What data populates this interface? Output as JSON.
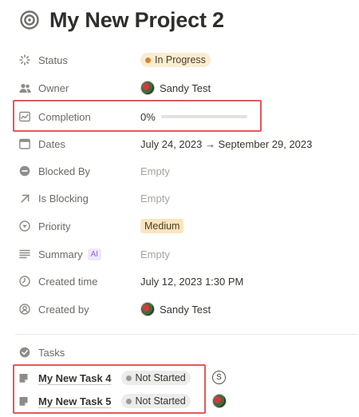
{
  "page": {
    "title": "My New Project 2",
    "icon": "target-icon"
  },
  "properties": [
    {
      "key": "status",
      "label": "Status",
      "icon": "status-spinner-icon",
      "value": "In Progress",
      "value_type": "status-pill",
      "color": "#d9822b"
    },
    {
      "key": "owner",
      "label": "Owner",
      "icon": "people-icon",
      "value": "Sandy Test",
      "value_type": "person"
    },
    {
      "key": "completion",
      "label": "Completion",
      "icon": "chart-line-icon",
      "value": "0%",
      "value_type": "progress",
      "progress_fraction": 0
    },
    {
      "key": "dates",
      "label": "Dates",
      "icon": "calendar-icon",
      "value": "July 24, 2023 → September 29, 2023",
      "value_type": "text"
    },
    {
      "key": "blocked_by",
      "label": "Blocked By",
      "icon": "minus-circle-icon",
      "value": "Empty",
      "value_type": "empty"
    },
    {
      "key": "is_blocking",
      "label": "Is Blocking",
      "icon": "arrow-up-right-icon",
      "value": "Empty",
      "value_type": "empty"
    },
    {
      "key": "priority",
      "label": "Priority",
      "icon": "chevron-circle-icon",
      "value": "Medium",
      "value_type": "select-pill",
      "color": "#fde4bf"
    },
    {
      "key": "summary",
      "label": "Summary",
      "icon": "lines-icon",
      "badge": "AI",
      "value": "Empty",
      "value_type": "empty"
    },
    {
      "key": "created_time",
      "label": "Created time",
      "icon": "clock-icon",
      "value": "July 12, 2023 1:30 PM",
      "value_type": "text"
    },
    {
      "key": "created_by",
      "label": "Created by",
      "icon": "person-circle-icon",
      "value": "Sandy Test",
      "value_type": "person"
    }
  ],
  "tasks": {
    "label": "Tasks",
    "icon": "check-circle-icon",
    "items": [
      {
        "name": "My New Task 4",
        "status": "Not Started",
        "assignee_initial": "S"
      },
      {
        "name": "My New Task 5",
        "status": "Not Started",
        "assignee_initial": ""
      }
    ]
  },
  "colors": {
    "highlight": "#e05a5a",
    "progress": "#2f80ed"
  }
}
